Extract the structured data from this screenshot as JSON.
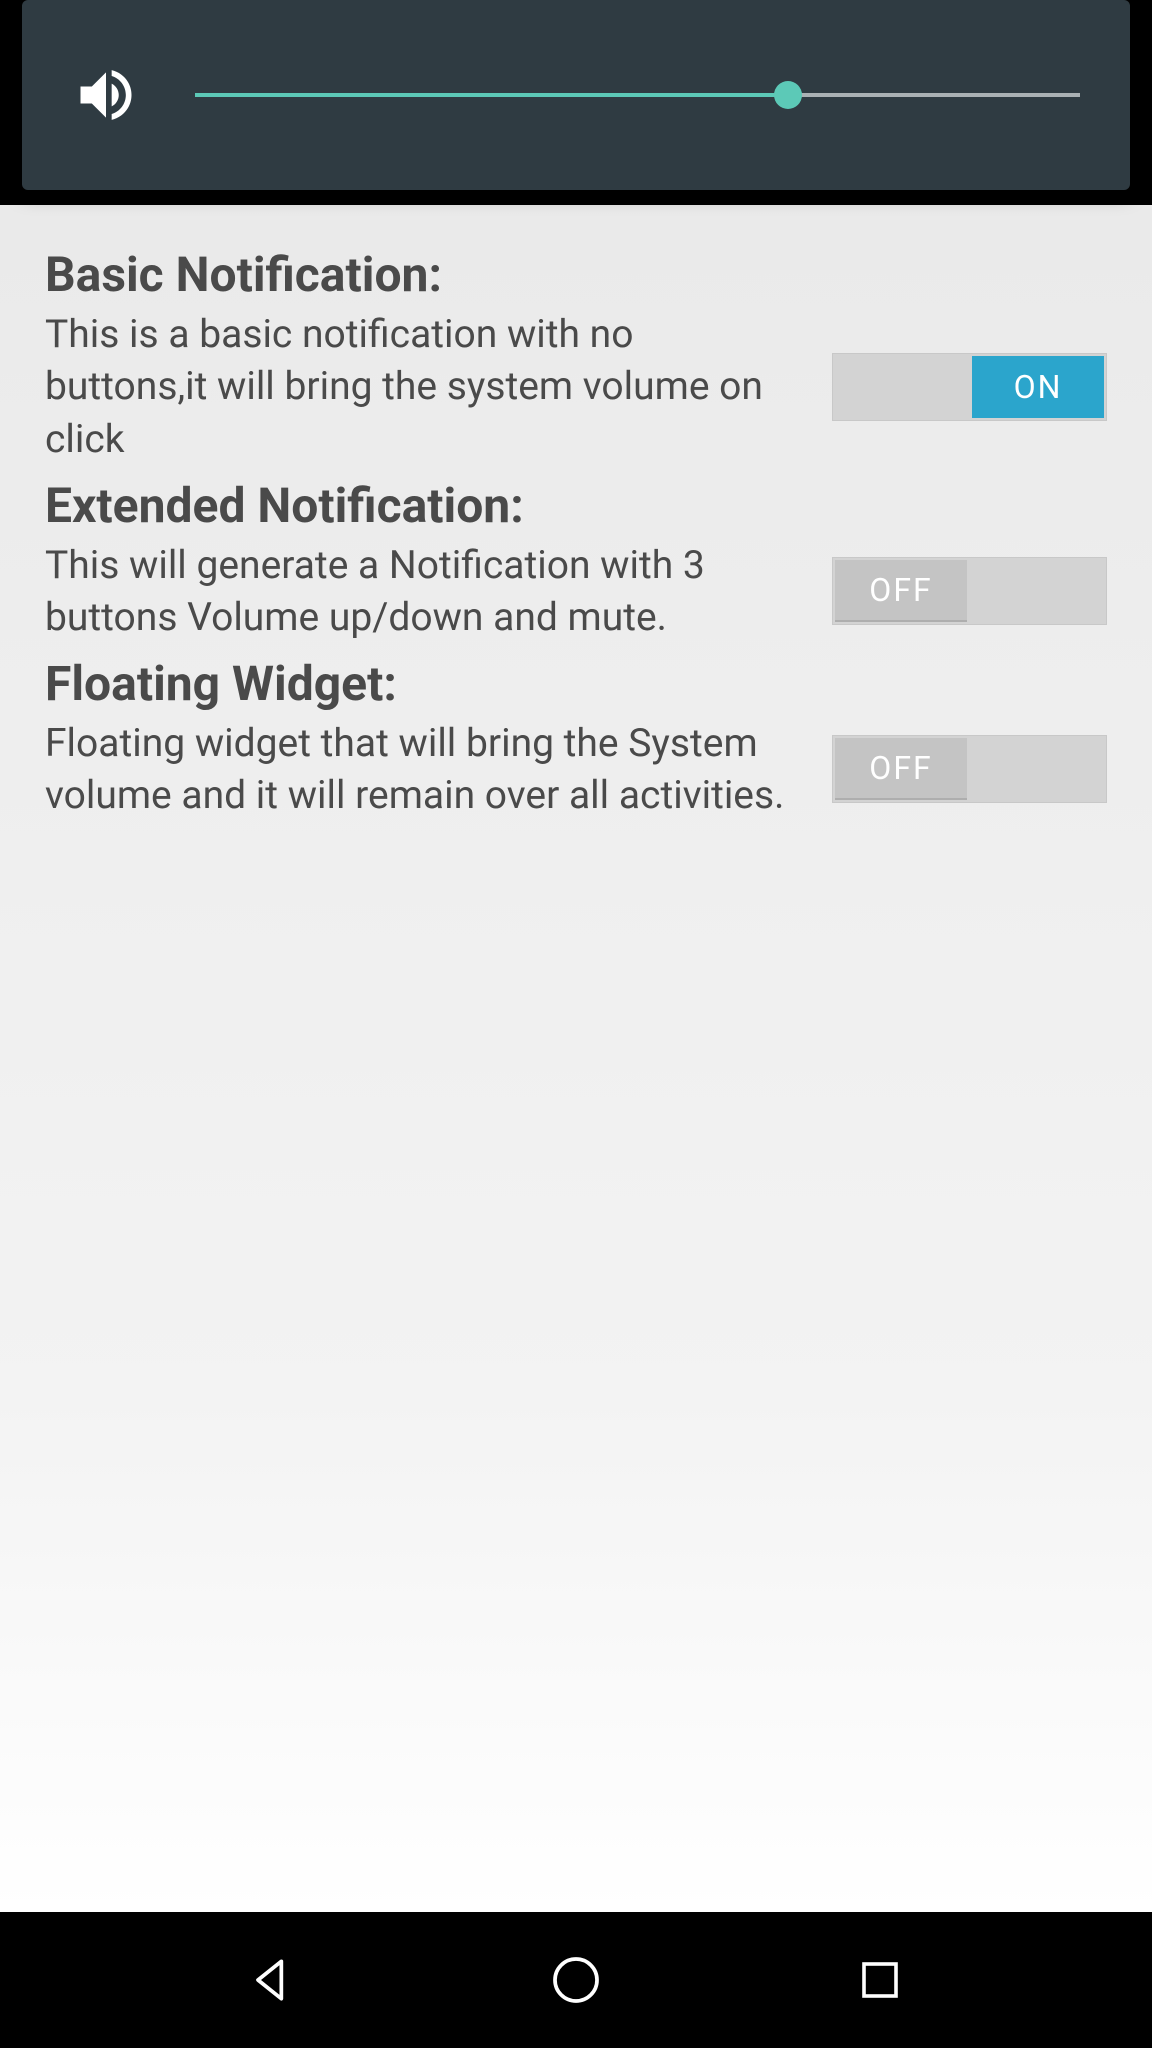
{
  "volume": {
    "level_percent": 67
  },
  "settings": [
    {
      "title": "Basic Notification:",
      "description": "This is a basic notification with no buttons,it will bring the system volume on click",
      "state": "on",
      "state_label": "ON"
    },
    {
      "title": "Extended Notification:",
      "description": "This will generate a Notification with 3 buttons Volume up/down and mute.",
      "state": "off",
      "state_label": "OFF"
    },
    {
      "title": "Floating Widget:",
      "description": "Floating widget that will bring the System volume and it will remain over all activities.",
      "state": "off",
      "state_label": "OFF"
    }
  ]
}
